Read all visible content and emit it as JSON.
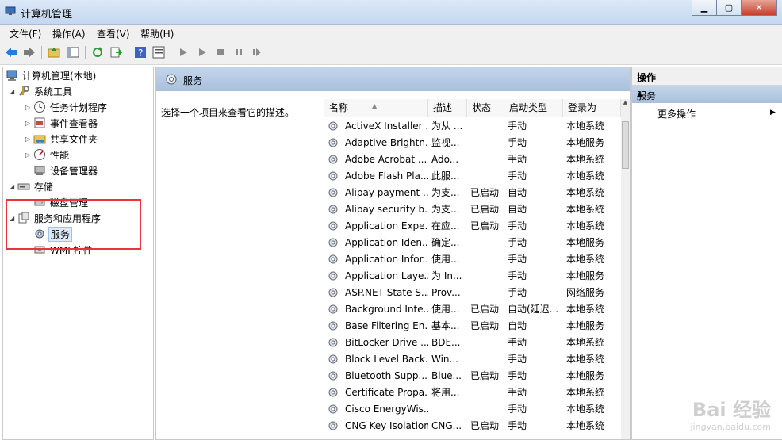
{
  "window": {
    "title": "计算机管理",
    "buttons": {
      "min": "▁",
      "max": "▢",
      "close": "✕"
    }
  },
  "menu": [
    "文件(F)",
    "操作(A)",
    "查看(V)",
    "帮助(H)"
  ],
  "toolbar_icons": [
    "back-icon",
    "forward-icon",
    "up-folder-icon",
    "show-hide-tree-icon",
    "refresh-icon",
    "export-icon",
    "help-icon",
    "properties-icon",
    "play-icon",
    "play-alt-icon",
    "stop-icon",
    "pause-icon",
    "resume-icon"
  ],
  "tree": {
    "root": "计算机管理(本地)",
    "system_tools": "系统工具",
    "task_scheduler": "任务计划程序",
    "event_viewer": "事件查看器",
    "shared_folders": "共享文件夹",
    "performance": "性能",
    "device_manager": "设备管理器",
    "storage": "存储",
    "disk_management": "磁盘管理",
    "services_apps": "服务和应用程序",
    "services": "服务",
    "wmi": "WMI 控件"
  },
  "center": {
    "header_title": "服务",
    "description": "选择一个项目来查看它的描述。",
    "columns": [
      "名称",
      "描述",
      "状态",
      "启动类型",
      "登录为"
    ],
    "rows": [
      [
        "ActiveX Installer ...",
        "为从 ...",
        "",
        "手动",
        "本地系统"
      ],
      [
        "Adaptive Brightn...",
        "监视...",
        "",
        "手动",
        "本地服务"
      ],
      [
        "Adobe Acrobat ...",
        "Ado...",
        "",
        "手动",
        "本地系统"
      ],
      [
        "Adobe Flash Pla...",
        "此服...",
        "",
        "手动",
        "本地系统"
      ],
      [
        "Alipay payment ...",
        "为支...",
        "已启动",
        "自动",
        "本地系统"
      ],
      [
        "Alipay security b...",
        "为支...",
        "已启动",
        "自动",
        "本地系统"
      ],
      [
        "Application Expe...",
        "在应...",
        "已启动",
        "手动",
        "本地系统"
      ],
      [
        "Application Iden...",
        "确定...",
        "",
        "手动",
        "本地服务"
      ],
      [
        "Application Infor...",
        "使用...",
        "",
        "手动",
        "本地系统"
      ],
      [
        "Application Laye...",
        "为 In...",
        "",
        "手动",
        "本地服务"
      ],
      [
        "ASP.NET State S...",
        "Prov...",
        "",
        "手动",
        "网络服务"
      ],
      [
        "Background Inte...",
        "使用...",
        "已启动",
        "自动(延迟...",
        "本地系统"
      ],
      [
        "Base Filtering En...",
        "基本...",
        "已启动",
        "自动",
        "本地服务"
      ],
      [
        "BitLocker Drive ...",
        "BDE...",
        "",
        "手动",
        "本地系统"
      ],
      [
        "Block Level Back...",
        "Win...",
        "",
        "手动",
        "本地系统"
      ],
      [
        "Bluetooth Supp...",
        "Blue...",
        "已启动",
        "手动",
        "本地服务"
      ],
      [
        "Certificate Propa...",
        "将用...",
        "",
        "手动",
        "本地系统"
      ],
      [
        "Cisco EnergyWis...",
        "",
        "",
        "手动",
        "本地系统"
      ],
      [
        "CNG Key Isolation",
        "CNG...",
        "已启动",
        "手动",
        "本地系统"
      ]
    ]
  },
  "actions": {
    "header": "操作",
    "section": "服务",
    "more": "更多操作"
  },
  "watermark": {
    "brand": "Bai 经验",
    "url": "jingyan.baidu.com"
  }
}
